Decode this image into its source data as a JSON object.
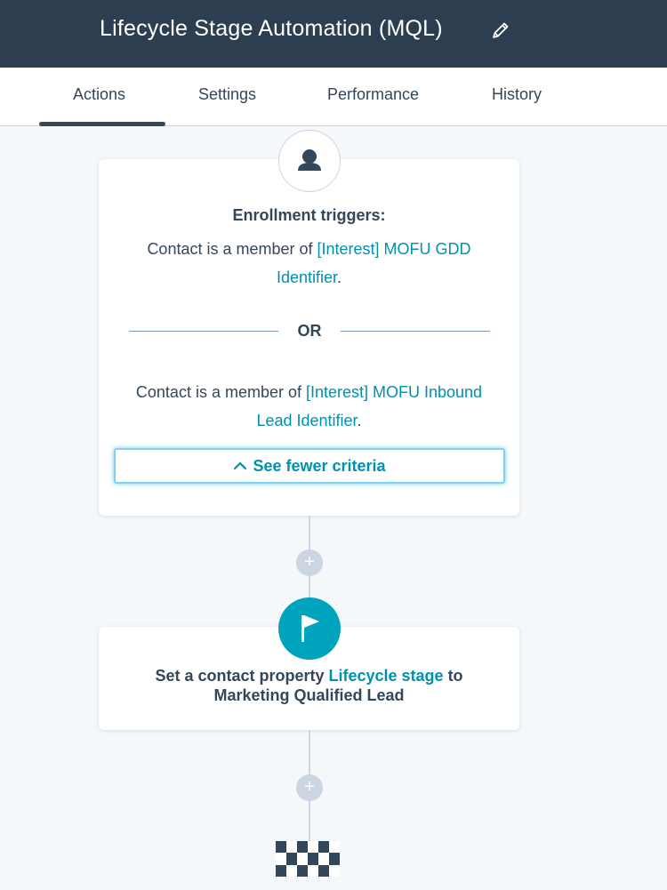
{
  "header": {
    "title": "Lifecycle Stage Automation (MQL)",
    "edit_icon": "pencil-icon"
  },
  "tabs": [
    {
      "label": "Actions",
      "active": true
    },
    {
      "label": "Settings",
      "active": false
    },
    {
      "label": "Performance",
      "active": false
    },
    {
      "label": "History",
      "active": false
    }
  ],
  "trigger_card": {
    "icon": "person-icon",
    "heading": "Enrollment triggers:",
    "criteria": [
      {
        "prefix": "Contact is a member of ",
        "link_line1": "[Interest] MOFU GDD",
        "link_line2": "Identifier",
        "suffix": "."
      },
      {
        "prefix": "Contact is a member of ",
        "link_line1": "[Interest] MOFU Inbound",
        "link_line2": "Lead Identifier",
        "suffix": "."
      }
    ],
    "or_label": "OR",
    "toggle_label": "See fewer criteria",
    "toggle_icon": "chevron-up-icon"
  },
  "connectors": {
    "plus_label": "+"
  },
  "action_card": {
    "icon": "flag-icon",
    "line1_prefix": "Set a contact property ",
    "line1_link": "Lifecycle stage",
    "line1_suffix": " to",
    "line2": "Marketing Qualified Lead"
  },
  "end": {
    "icon": "checkered-flag-icon"
  },
  "colors": {
    "header_bg": "#2d3e50",
    "accent": "#00a4bd",
    "link": "#0091ae",
    "text": "#33475b",
    "page_bg": "#f5f8fa"
  }
}
